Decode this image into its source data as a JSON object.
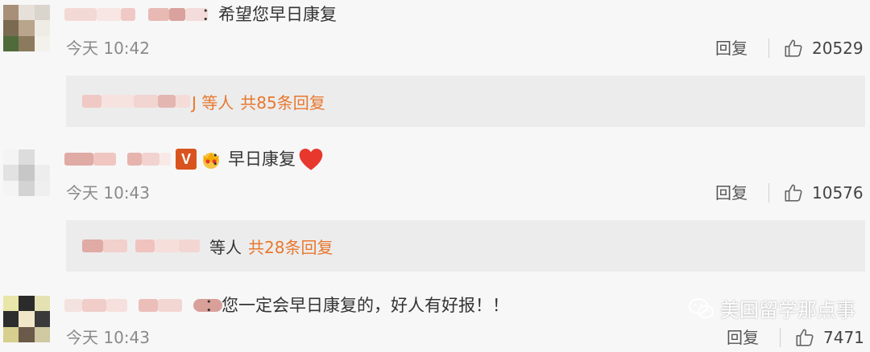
{
  "comments": [
    {
      "text": "：希望您早日康复",
      "time": "今天 10:42",
      "reply_label": "回复",
      "likes": "20529",
      "replies_who": "J 等人",
      "replies_count": "共85条回复"
    },
    {
      "text": "：早日康复",
      "time": "今天 10:43",
      "reply_label": "回复",
      "likes": "10576",
      "replies_who": "等人",
      "replies_count": "共28条回复",
      "badge": "V"
    },
    {
      "text": "：您一定会早日康复的，好人有好报！！",
      "time": "今天 10:43",
      "reply_label": "回复",
      "likes": "7471"
    }
  ],
  "watermark": {
    "text": "美国留学那点事",
    "icon": "wechat-icon"
  },
  "colors": {
    "accent": "#e8772e",
    "heart": "#e8382e",
    "badge": "#d9531e"
  }
}
